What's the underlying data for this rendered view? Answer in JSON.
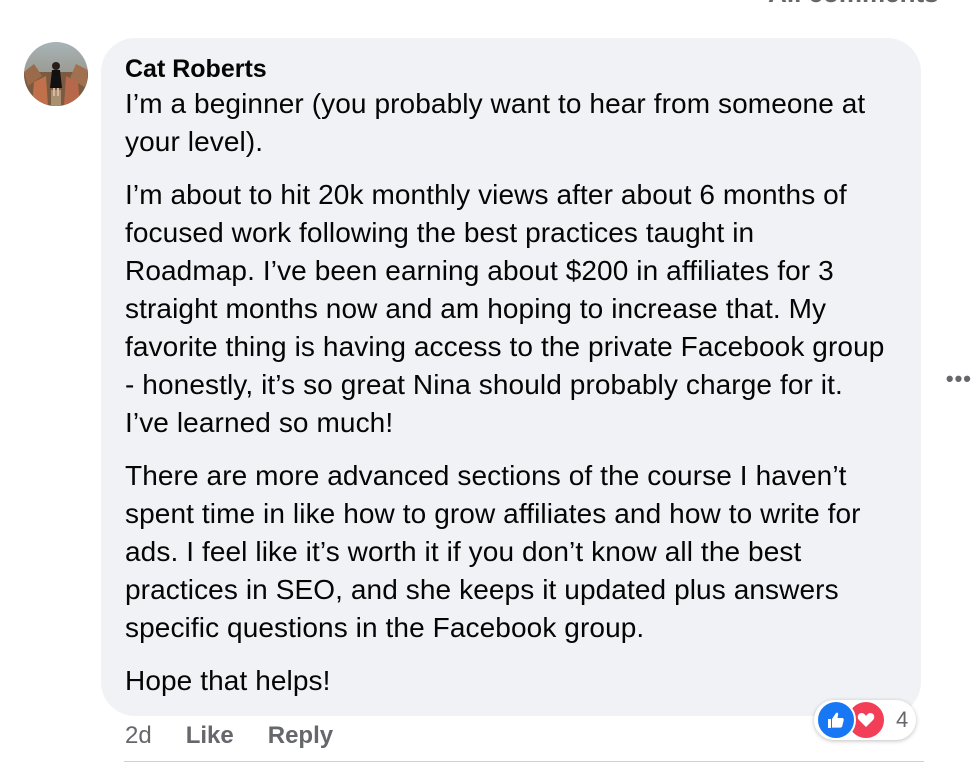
{
  "header": {
    "sort_label": "All comments"
  },
  "comment": {
    "author": "Cat Roberts",
    "paragraphs": [
      "I’m a beginner (you probably want to hear from someone at your level).",
      "I’m about to hit 20k monthly views after about 6 months of focused work following the best practices taught in Roadmap. I’ve been earning about $200 in affiliates for 3 straight months now and am hoping to increase that. My favorite thing is having access to the private Facebook group - honestly, it’s so great Nina should probably charge for it. I’ve learned so much!",
      "There are more advanced sections of the course I haven’t spent time in like how to grow affiliates and how to write for ads. I feel like it’s worth it if you don’t know all the best practices in SEO, and she keeps it updated plus answers specific questions in the Facebook group.",
      "Hope that helps!"
    ],
    "time": "2d",
    "like_label": "Like",
    "reply_label": "Reply",
    "reaction_count": "4",
    "reaction_icons": [
      "like-icon",
      "love-icon"
    ],
    "more_icon": "more-options-icon"
  },
  "colors": {
    "bubble_bg": "#f0f2f5",
    "secondary_text": "#65676b",
    "like_blue": "#1877f2",
    "love_red": "#f33e58"
  }
}
